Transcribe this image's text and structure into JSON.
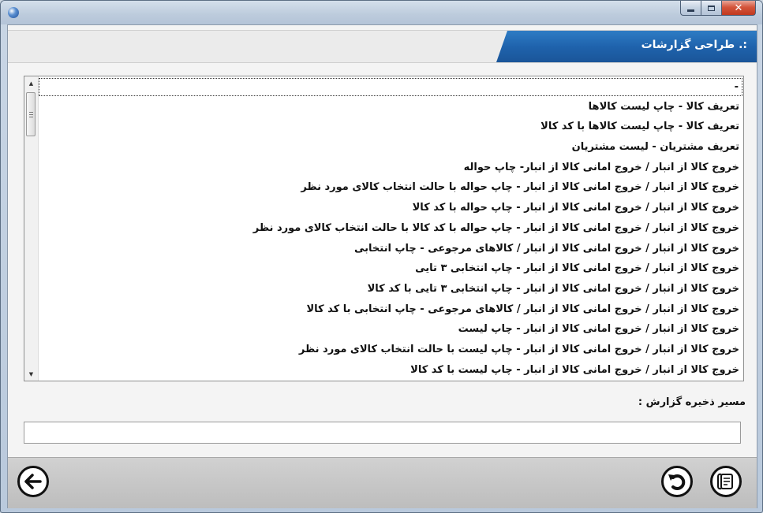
{
  "window": {
    "title": "",
    "controls": {
      "minimize": "minimize",
      "maximize": "maximize",
      "close": "✕"
    }
  },
  "header": {
    "title": ":. طراحی گزارشات"
  },
  "report_list": {
    "items": [
      "-",
      "تعریف کالا - چاپ لیست کالاها",
      "تعریف کالا - چاپ لیست کالاها با کد کالا",
      "تعریف مشتریان - لیست مشتریان",
      "خروج کالا از انبار / خروج امانی کالا از انبار- چاپ حواله",
      "خروج کالا از انبار / خروج امانی کالا از انبار - چاپ حواله با حالت انتخاب کالای مورد نظر",
      "خروج کالا از انبار / خروج امانی کالا از انبار - چاپ حواله با کد کالا",
      "خروج کالا از انبار / خروج امانی کالا از انبار - چاپ حواله با کد کالا با حالت انتخاب کالای مورد نظر",
      "خروج کالا از انبار / خروج امانی کالا از انبار / کالاهای مرجوعی - چاپ انتخابی",
      "خروج کالا از انبار / خروج امانی کالا از انبار - چاپ انتخابی ۳ تایی",
      "خروج کالا از انبار / خروج امانی کالا از انبار - چاپ انتخابی ۳ تایی با کد کالا",
      "خروج کالا از انبار / خروج امانی کالا از انبار / کالاهای مرجوعی - چاپ انتخابی با کد کالا",
      "خروج کالا از انبار / خروج امانی کالا از انبار - چاپ لیست",
      "خروج کالا از انبار / خروج امانی کالا از انبار - چاپ لیست با حالت انتخاب کالای مورد نظر",
      "خروج کالا از انبار / خروج امانی کالا از انبار - چاپ لیست با کد کالا"
    ]
  },
  "save_path": {
    "label": "مسیر ذخیره گزارش :",
    "value": ""
  },
  "icons": {
    "back": "arrow-left-icon",
    "undo": "undo-icon",
    "design": "report-design-icon"
  },
  "colors": {
    "header_blue": "#1f63ad",
    "window_frame": "#b9c9dc"
  }
}
